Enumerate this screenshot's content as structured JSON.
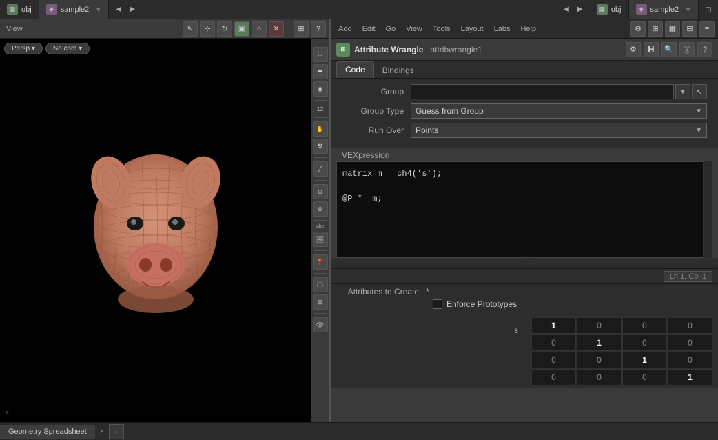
{
  "window": {
    "tabs": [
      {
        "id": "obj1",
        "label": "obj",
        "icon": "obj",
        "active": false
      },
      {
        "id": "sample2",
        "label": "sample2",
        "active": true
      }
    ],
    "right_tabs": [
      {
        "id": "obj2",
        "label": "obj",
        "icon": "obj",
        "active": false
      },
      {
        "id": "sample2r",
        "label": "sample2",
        "active": true
      }
    ]
  },
  "menu": {
    "items": [
      "Add",
      "Edit",
      "Go",
      "View",
      "Tools",
      "Layout",
      "Labs",
      "Help"
    ]
  },
  "viewport": {
    "label": "View",
    "camera_buttons": [
      "Persp ▾",
      "No cam ▾"
    ],
    "tools": [
      "arrow",
      "select",
      "transform",
      "box",
      "circle",
      "X"
    ]
  },
  "aw_header": {
    "title": "Attribute Wrangle",
    "node_name": "attribwrangle1"
  },
  "panel_tabs": [
    {
      "label": "Code",
      "active": true
    },
    {
      "label": "Bindings",
      "active": false
    }
  ],
  "form": {
    "group_label": "Group",
    "group_value": "",
    "group_type_label": "Group Type",
    "group_type_value": "Guess from Group",
    "run_over_label": "Run Over",
    "run_over_value": "Points"
  },
  "vex": {
    "label": "VEXpression",
    "line1": "matrix m = ch4('s');",
    "line2": "",
    "line3": "@P *= m;",
    "status": "Ln 1, Col 1"
  },
  "attrs": {
    "label": "Attributes to Create",
    "value": "*",
    "enforce_label": "Enforce Prototypes"
  },
  "matrix": {
    "s_label": "s",
    "rows": [
      [
        {
          "val": "1",
          "bold": true
        },
        {
          "val": "0"
        },
        {
          "val": "0"
        },
        {
          "val": "0"
        }
      ],
      [
        {
          "val": "0"
        },
        {
          "val": "1",
          "bold": true
        },
        {
          "val": "0"
        },
        {
          "val": "0"
        }
      ],
      [
        {
          "val": "0"
        },
        {
          "val": "0"
        },
        {
          "val": "1",
          "bold": true
        },
        {
          "val": "0"
        }
      ],
      [
        {
          "val": "0"
        },
        {
          "val": "0"
        },
        {
          "val": "0"
        },
        {
          "val": "1",
          "bold": true
        }
      ]
    ]
  },
  "bottom": {
    "tab_label": "Geometry Spreadsheet",
    "close_label": "×",
    "add_label": "+"
  }
}
